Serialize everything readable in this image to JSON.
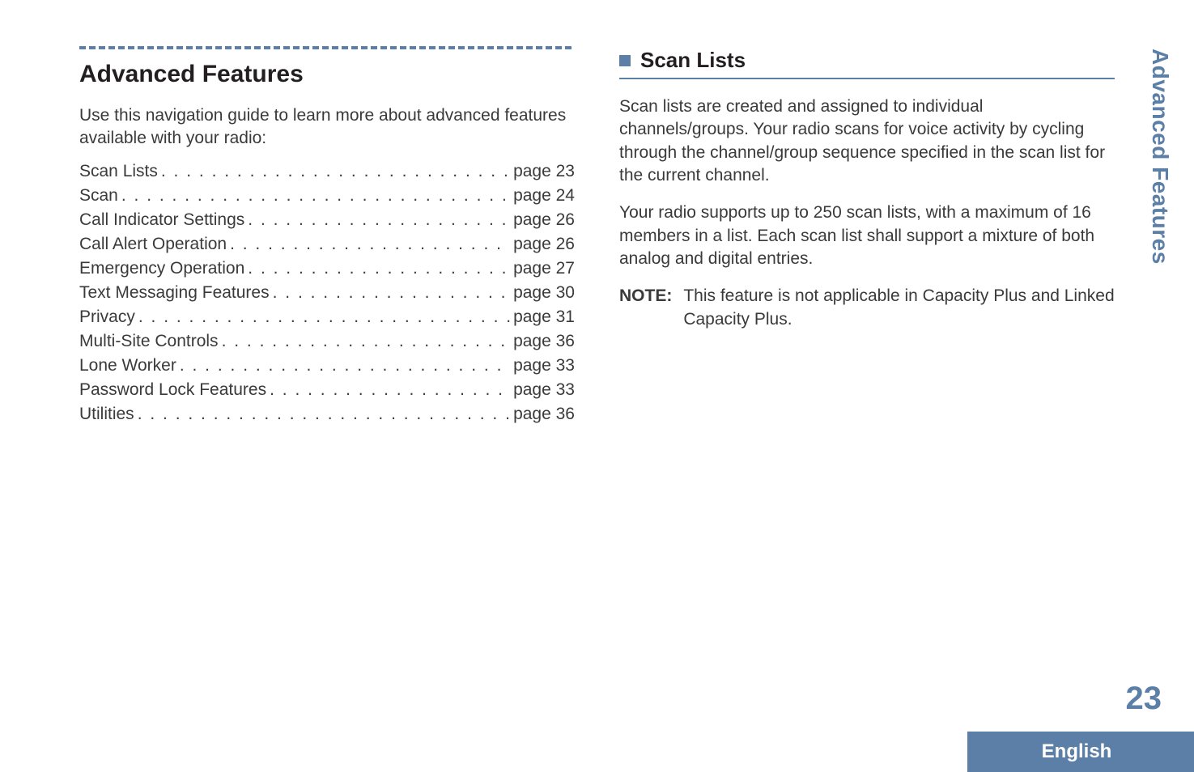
{
  "left": {
    "chapter_title": "Advanced Features",
    "intro": "Use this navigation guide to learn more about advanced features available with your radio:",
    "toc": [
      {
        "label": "Scan Lists",
        "page": "page 23"
      },
      {
        "label": "Scan",
        "page": "page 24"
      },
      {
        "label": "Call Indicator Settings",
        "page": "page 26"
      },
      {
        "label": "Call Alert Operation",
        "page": "page 26"
      },
      {
        "label": "Emergency Operation",
        "page": "page 27"
      },
      {
        "label": "Text Messaging Features",
        "page": "page 30"
      },
      {
        "label": "Privacy",
        "page": "page 31"
      },
      {
        "label": "Multi-Site Controls",
        "page": "page 36"
      },
      {
        "label": "Lone Worker",
        "page": "page 33"
      },
      {
        "label": "Password Lock Features",
        "page": "page 33"
      },
      {
        "label": "Utilities",
        "page": "page 36"
      }
    ]
  },
  "right": {
    "section_title": "Scan Lists",
    "para1": "Scan lists are created and assigned to individual channels/groups. Your radio scans for voice activity by cycling through the channel/group sequence specified in the scan list for the current channel.",
    "para2": "Your radio supports up to 250 scan lists, with a maximum of 16 members in a list. Each scan list shall support a mixture of both analog and digital entries.",
    "note_label": "NOTE:",
    "note_body": "This feature is not applicable in Capacity Plus and Linked Capacity Plus."
  },
  "side_tab": "Advanced Features",
  "page_number": "23",
  "language": "English"
}
